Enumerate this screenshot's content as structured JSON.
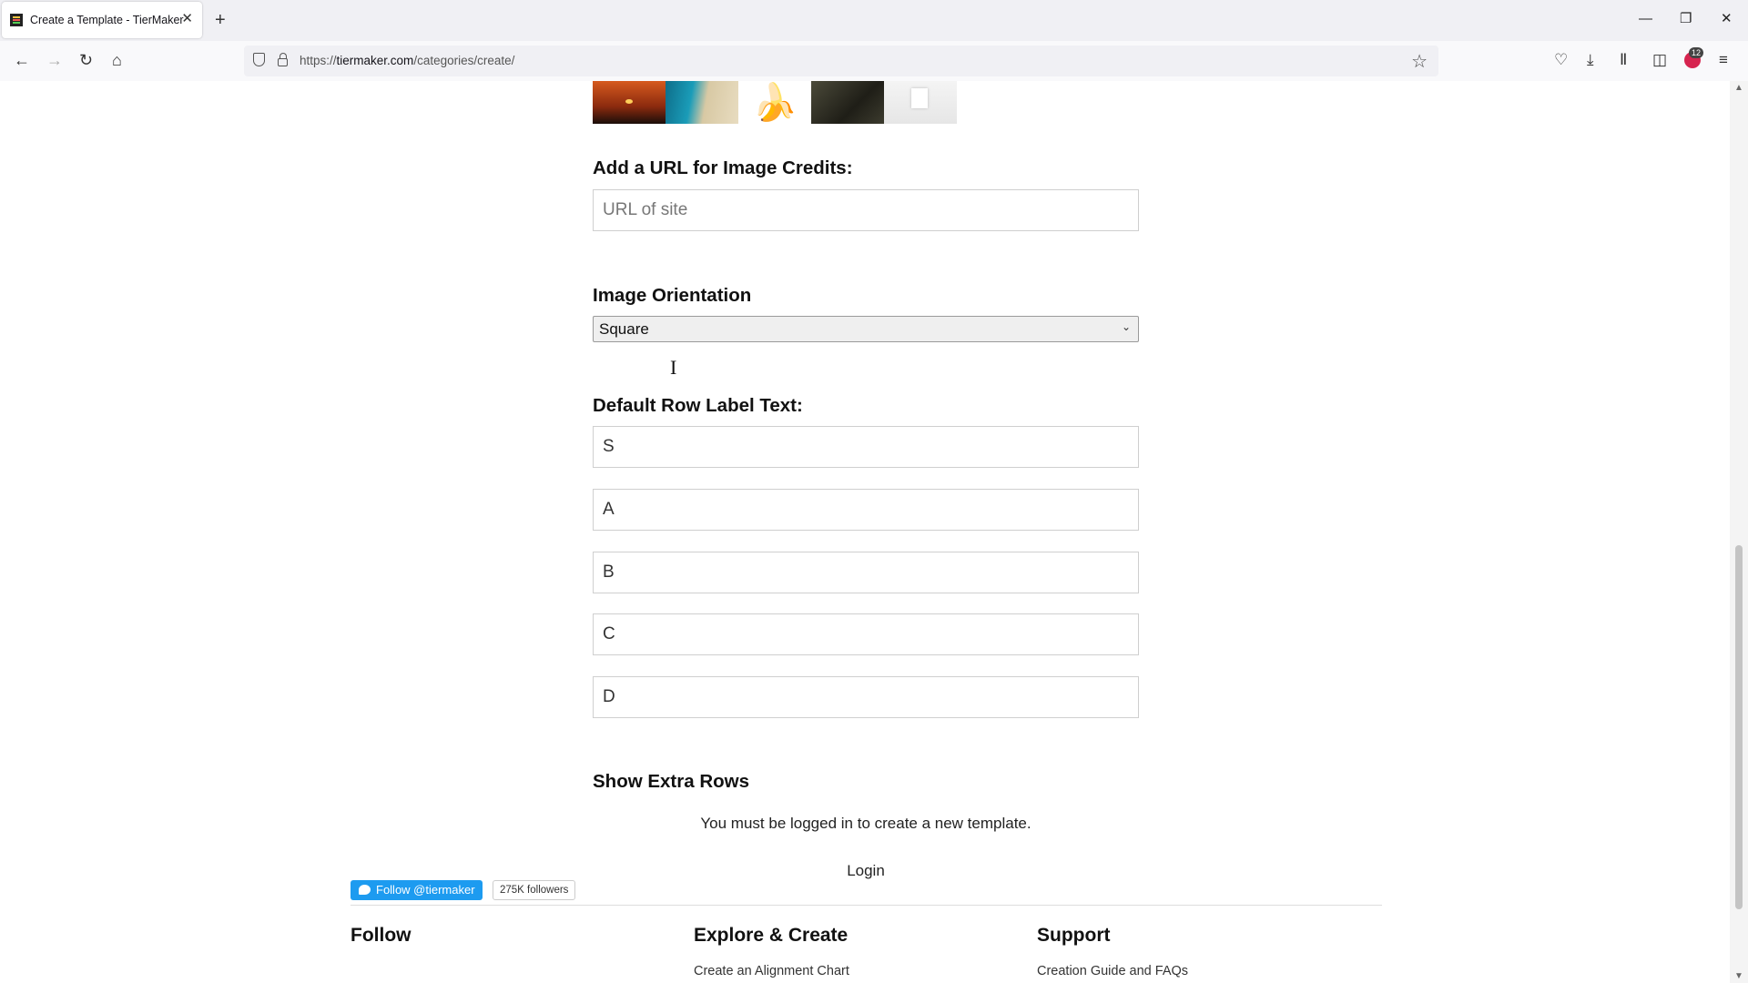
{
  "browser": {
    "tab_title": "Create a Template - TierMaker",
    "tab_close": "✕",
    "new_tab": "+",
    "url_prefix": "https://",
    "url_domain": "tiermaker.com",
    "url_path": "/categories/create/",
    "extension_badge": "12",
    "icons": [
      "back-arrow-icon",
      "forward-arrow-icon",
      "reload-icon",
      "home-icon",
      "shield-icon",
      "lock-icon",
      "bookmark-star-icon",
      "pocket-icon",
      "download-icon",
      "library-icon",
      "sidebar-icon",
      "account-icon",
      "menu-icon",
      "minimize-icon",
      "restore-icon",
      "close-icon"
    ]
  },
  "page": {
    "thumbnails": [
      "sunset",
      "beach",
      "banana",
      "horse",
      "room"
    ],
    "image_credits": {
      "label": "Add a URL for Image Credits:",
      "placeholder": "URL of site"
    },
    "orientation": {
      "label": "Image Orientation",
      "selected": "Square"
    },
    "row_labels": {
      "label": "Default Row Label Text:",
      "rows": [
        "S",
        "A",
        "B",
        "C",
        "D"
      ]
    },
    "extra_rows_label": "Show Extra Rows",
    "login_notice": "You must be logged in to create a new template.",
    "login_link": "Login"
  },
  "footer": {
    "follow": {
      "heading": "Follow",
      "twitter_button": "Follow @tiermaker",
      "followers": "275K followers"
    },
    "explore": {
      "heading": "Explore & Create",
      "link": "Create an Alignment Chart"
    },
    "support": {
      "heading": "Support",
      "link": "Creation Guide and FAQs"
    }
  }
}
